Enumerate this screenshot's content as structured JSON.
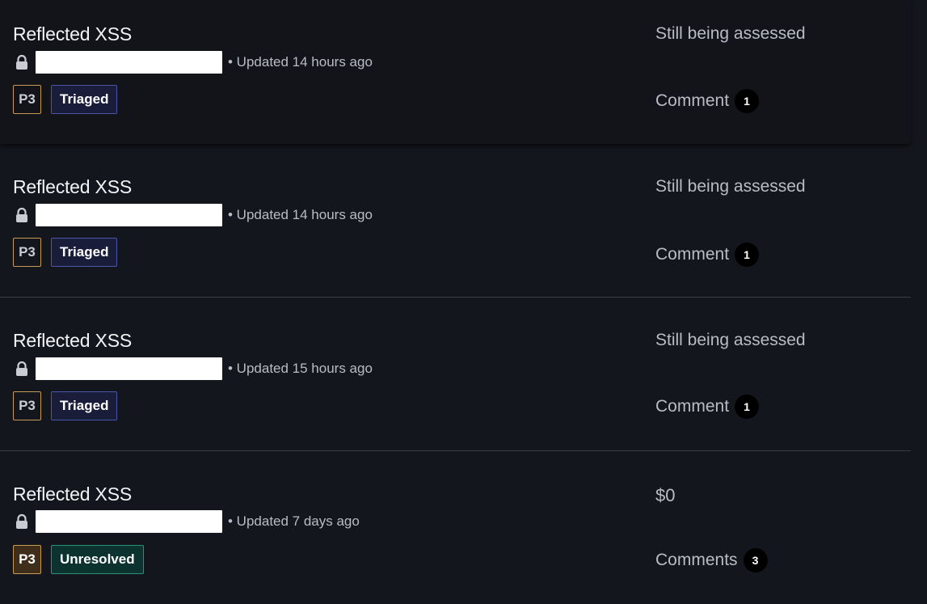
{
  "reports": [
    {
      "title": "Reflected XSS",
      "updated": "• Updated 14 hours ago",
      "priority": "P3",
      "state": "Triaged",
      "bounty": "Still being assessed",
      "comments_label": "Comment",
      "comments_count": "1"
    },
    {
      "title": "Reflected XSS",
      "updated": "• Updated 14 hours ago",
      "priority": "P3",
      "state": "Triaged",
      "bounty": "Still being assessed",
      "comments_label": "Comment",
      "comments_count": "1"
    },
    {
      "title": "Reflected XSS",
      "updated": "• Updated 15 hours ago",
      "priority": "P3",
      "state": "Triaged",
      "bounty": "Still being assessed",
      "comments_label": "Comment",
      "comments_count": "1"
    },
    {
      "title": "Reflected XSS",
      "updated": "• Updated 7 days ago",
      "priority": "P3",
      "state": "Unresolved",
      "bounty": "$0",
      "comments_label": "Comments",
      "comments_count": "3"
    }
  ],
  "icons": {
    "lock": "lock-icon"
  },
  "colors": {
    "background": "#14161d",
    "triaged_border": "#4a55a8",
    "unresolved_border": "#2e8f78",
    "priority_border": "#c89a55"
  }
}
